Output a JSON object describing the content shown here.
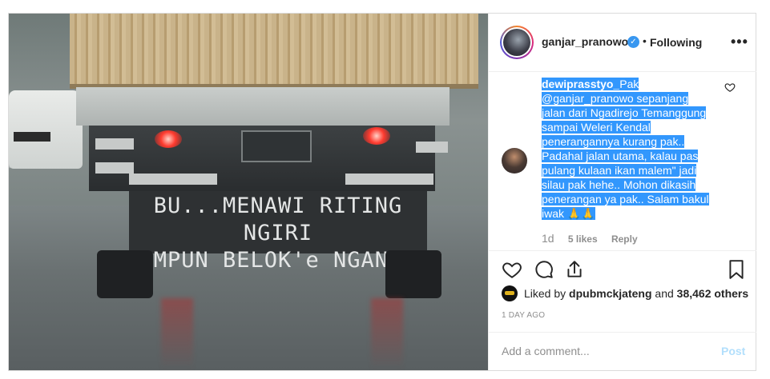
{
  "photo": {
    "mudflap_line1": "BU...MENAWI RITING NGIRI",
    "mudflap_line2": "AMPUN BELOK'e NGANAN"
  },
  "header": {
    "username": "ganjar_pranowo",
    "verified_icon": "verified-badge-icon",
    "separator": "•",
    "follow_status": "Following",
    "more_label": "•••"
  },
  "comment": {
    "username": "dewiprasstyo_",
    "lines": [
      "Pak",
      "@ganjar_pranowo sepanjang",
      "jalan dari Ngadirejo Temanggung",
      "sampai Weleri Kendal",
      "penerangannya kurang pak..",
      "Padahal jalan utama, kalau pas",
      "pulang kulaan ikan malem\" jadi",
      "silau pak hehe.. Mohon dikasih",
      "penerangan ya pak.. Salam bakul",
      "iwak 🙏🙏"
    ],
    "time": "1d",
    "likes": "5 likes",
    "reply": "Reply",
    "highlight_color": "#3297fd"
  },
  "likes": {
    "prefix": "Liked by ",
    "user": "dpubmckjateng",
    "middle": " and ",
    "count": "38,462 others"
  },
  "timestamp": "1 DAY AGO",
  "add_comment": {
    "placeholder": "Add a comment...",
    "post_label": "Post"
  },
  "colors": {
    "verified": "#3897f0",
    "post_button_disabled": "#b2dffc"
  }
}
